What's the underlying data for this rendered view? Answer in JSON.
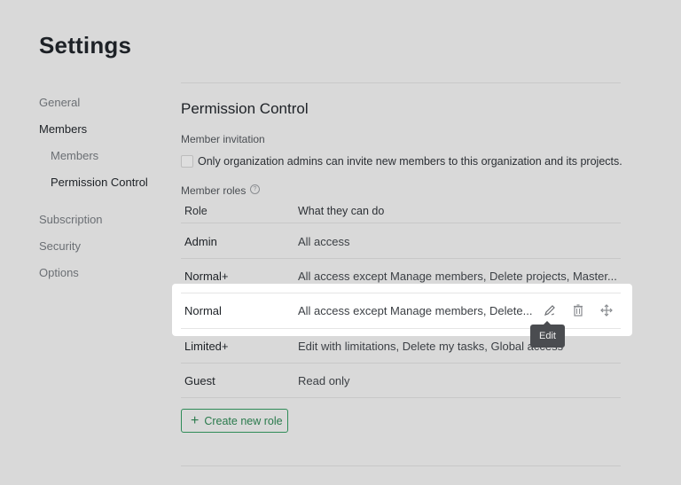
{
  "page": {
    "title": "Settings"
  },
  "sidebar": {
    "items": [
      {
        "label": "General",
        "active": false,
        "level": 0
      },
      {
        "label": "Members",
        "active": true,
        "level": 0
      },
      {
        "label": "Members",
        "active": false,
        "level": 1
      },
      {
        "label": "Permission Control",
        "active": true,
        "level": 1
      },
      {
        "label": "Subscription",
        "active": false,
        "level": 0
      },
      {
        "label": "Security",
        "active": false,
        "level": 0
      },
      {
        "label": "Options",
        "active": false,
        "level": 0
      }
    ]
  },
  "main": {
    "section_title": "Permission Control",
    "invitation": {
      "label": "Member invitation",
      "checkbox_label": "Only organization admins can invite new members to this organization and its projects.",
      "checked": false
    },
    "roles": {
      "label": "Member roles",
      "help_icon": "?",
      "columns": [
        "Role",
        "What they can do"
      ],
      "rows": [
        {
          "role": "Admin",
          "desc": "All access"
        },
        {
          "role": "Normal+",
          "desc": "All access except Manage members, Delete projects, Master..."
        },
        {
          "role": "Normal",
          "desc": "All access except Manage members, Delete..."
        },
        {
          "role": "Limited+",
          "desc": "Edit with limitations, Delete my tasks, Global access"
        },
        {
          "role": "Guest",
          "desc": "Read only"
        }
      ],
      "hovered_row_actions": [
        "edit-icon",
        "trash-icon",
        "move-icon"
      ],
      "tooltip": "Edit",
      "create_button": "Create new role"
    }
  },
  "colors": {
    "accent": "#2a7a4c",
    "background": "#d9d9d9",
    "tooltip_bg": "#4a4c50"
  }
}
